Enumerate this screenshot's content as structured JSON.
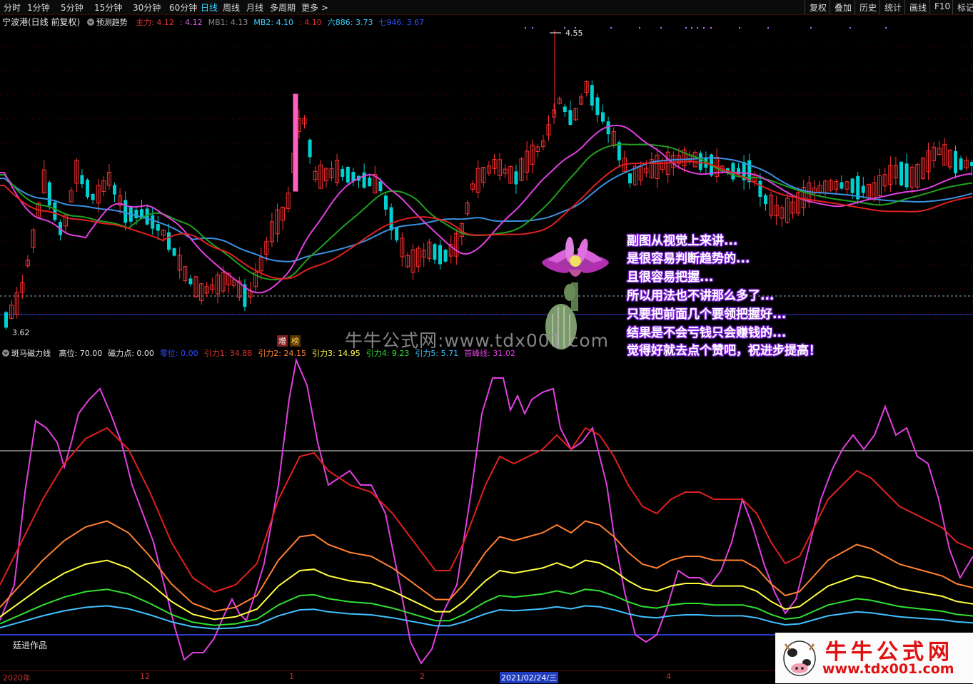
{
  "toolbar": {
    "periods": [
      "分时",
      "1分钟",
      "5分钟",
      "15分钟",
      "30分钟",
      "60分钟",
      "日线",
      "周线",
      "月线",
      "多周期",
      "更多 >"
    ],
    "active": "日线",
    "right_buttons": [
      "复权",
      "叠加",
      "历史",
      "统计",
      "画线",
      "F10",
      "标记"
    ]
  },
  "main_header": {
    "stock": "宁波港(日线 前复权)",
    "indicator": "预测趋势",
    "items": [
      {
        "label": "主力: 4.12",
        "color": "#e03030"
      },
      {
        "label": ": 4.12",
        "color": "#e060e0"
      },
      {
        "label": "MB1: 4.13",
        "color": "#8a8a8a"
      },
      {
        "label": "MB2: 4.10",
        "color": "#3ad0ff"
      },
      {
        "label": ": 4.10",
        "color": "#e03030"
      },
      {
        "label": "六886: 3.73",
        "color": "#3ad0ff"
      },
      {
        "label": "七946: 3.67",
        "color": "#3050ff"
      }
    ]
  },
  "price_labels": {
    "high": "4.55",
    "low": "3.62"
  },
  "sub_header": {
    "indicator": "斑马磁力线",
    "items": [
      {
        "label": "高位: 70.00",
        "color": "#e6e6e6"
      },
      {
        "label": "磁力点: 0.00",
        "color": "#e6e6e6"
      },
      {
        "label": "零位: 0.00",
        "color": "#3050ff"
      },
      {
        "label": "引力1: 34.88",
        "color": "#e03030"
      },
      {
        "label": "引力2: 24.15",
        "color": "#ff8030"
      },
      {
        "label": "引力3: 14.95",
        "color": "#ffff40"
      },
      {
        "label": "引力4: 9.23",
        "color": "#30e030"
      },
      {
        "label": "引力5: 5.71",
        "color": "#40c0ff"
      },
      {
        "label": "首峰线: 31.02",
        "color": "#e040e0"
      }
    ]
  },
  "messages": [
    "副图从视觉上来讲...",
    "是很容易判断趋势的...",
    "且很容易把握...",
    "所以用法也不讲那么多了...",
    "只要把前面几个要领把握好...",
    "结果是不会亏钱只会赚钱的...",
    "觉得好就去点个赞吧，祝进步提高！"
  ],
  "watermark": "牛牛公式网:www.tdx001.com",
  "tags": [
    "增",
    "榜"
  ],
  "author": "廷进作品",
  "time_axis": [
    {
      "label": "2020年"
    },
    {
      "label": "12"
    },
    {
      "label": "1"
    },
    {
      "label": "2"
    },
    {
      "label": "2021/02/24/三",
      "selected": true
    },
    {
      "label": "4"
    }
  ],
  "logo": {
    "title": "牛牛公式网",
    "url": "www.tdx001.com"
  },
  "colors": {
    "up": "#ff3030",
    "down": "#00d0d0",
    "ma_red": "#e02020",
    "ma_magenta": "#e040e0",
    "ma_green": "#20a020",
    "ma_blue": "#3a90e0"
  },
  "chart_data": [
    {
      "type": "candlestick",
      "title": "宁波港(日线 前复权)",
      "series_names": [
        "主力",
        "MB1",
        "MB2",
        "六886",
        "七946"
      ],
      "annotations": {
        "high": 4.55,
        "low": 3.62
      }
    },
    {
      "type": "line",
      "title": "斑马磁力线",
      "series": [
        {
          "name": "首峰线",
          "value": 31.02
        },
        {
          "name": "引力1",
          "value": 34.88
        },
        {
          "name": "引力2",
          "value": 24.15
        },
        {
          "name": "引力3",
          "value": 14.95
        },
        {
          "name": "引力4",
          "value": 9.23
        },
        {
          "name": "引力5",
          "value": 5.71
        }
      ],
      "reference_lines": [
        {
          "name": "高位",
          "value": 70.0
        },
        {
          "name": "零位",
          "value": 0.0
        }
      ]
    }
  ]
}
